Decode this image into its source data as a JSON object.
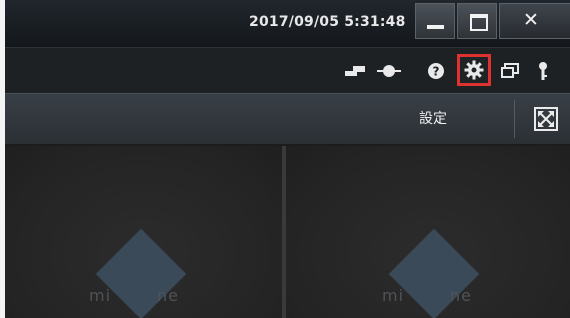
{
  "window": {
    "datetime": "2017/09/05 5:31:48",
    "minimize_icon": "minimize-icon",
    "maximize_icon": "maximize-icon",
    "close_icon": "close-icon",
    "close_glyph": "✕"
  },
  "toolbar": {
    "icons": [
      "device-icon",
      "connection-icon",
      "help-icon",
      "settings-icon",
      "window-layout-icon",
      "key-icon"
    ],
    "highlight_color": "#e03131"
  },
  "header": {
    "settings_label": "設定",
    "fit_icon": "fit-to-window-icon"
  },
  "panes": [
    {
      "logo_start": "mi",
      "logo_end": "ne"
    },
    {
      "logo_start": "mi",
      "logo_end": "ne"
    }
  ],
  "colors": {
    "accent_highlight": "#e03131",
    "logo": "#3b4a58"
  }
}
